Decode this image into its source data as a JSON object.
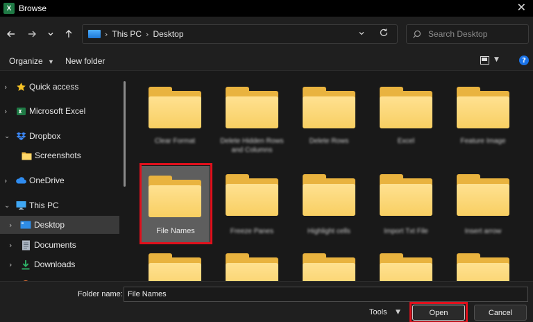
{
  "window": {
    "title": "Browse",
    "app_icon": "X"
  },
  "address": {
    "crumbs": [
      "This PC",
      "Desktop"
    ],
    "search_placeholder": "Search Desktop"
  },
  "commands": {
    "organize": "Organize",
    "new_folder": "New folder",
    "help": "?"
  },
  "sidebar": {
    "items": [
      {
        "label": "Quick access",
        "icon": "star-icon"
      },
      {
        "label": "Microsoft Excel",
        "icon": "excel-icon"
      },
      {
        "label": "Dropbox",
        "icon": "dropbox-icon"
      },
      {
        "label": "Screenshots",
        "icon": "folder-icon"
      },
      {
        "label": "OneDrive",
        "icon": "cloud-icon"
      },
      {
        "label": "This PC",
        "icon": "monitor-icon"
      },
      {
        "label": "Desktop",
        "icon": "desktop-icon"
      },
      {
        "label": "Documents",
        "icon": "document-icon"
      },
      {
        "label": "Downloads",
        "icon": "download-icon"
      }
    ]
  },
  "folders": {
    "row1": [
      "Clear Format",
      "Delete Hidden Rows and Columns",
      "Delete Rows",
      "Excel",
      "Feature Image"
    ],
    "row2": [
      "File Names",
      "Freeze Panes",
      "Highlight cells",
      "Import Txt File",
      "Insert arrow"
    ]
  },
  "footer": {
    "folder_name_label": "Folder name:",
    "folder_name_value": "File Names",
    "tools_label": "Tools",
    "open_label": "Open",
    "cancel_label": "Cancel"
  },
  "colors": {
    "accent": "#1a73e8",
    "highlight": "#e0101c",
    "folder": "#f8cf62"
  }
}
